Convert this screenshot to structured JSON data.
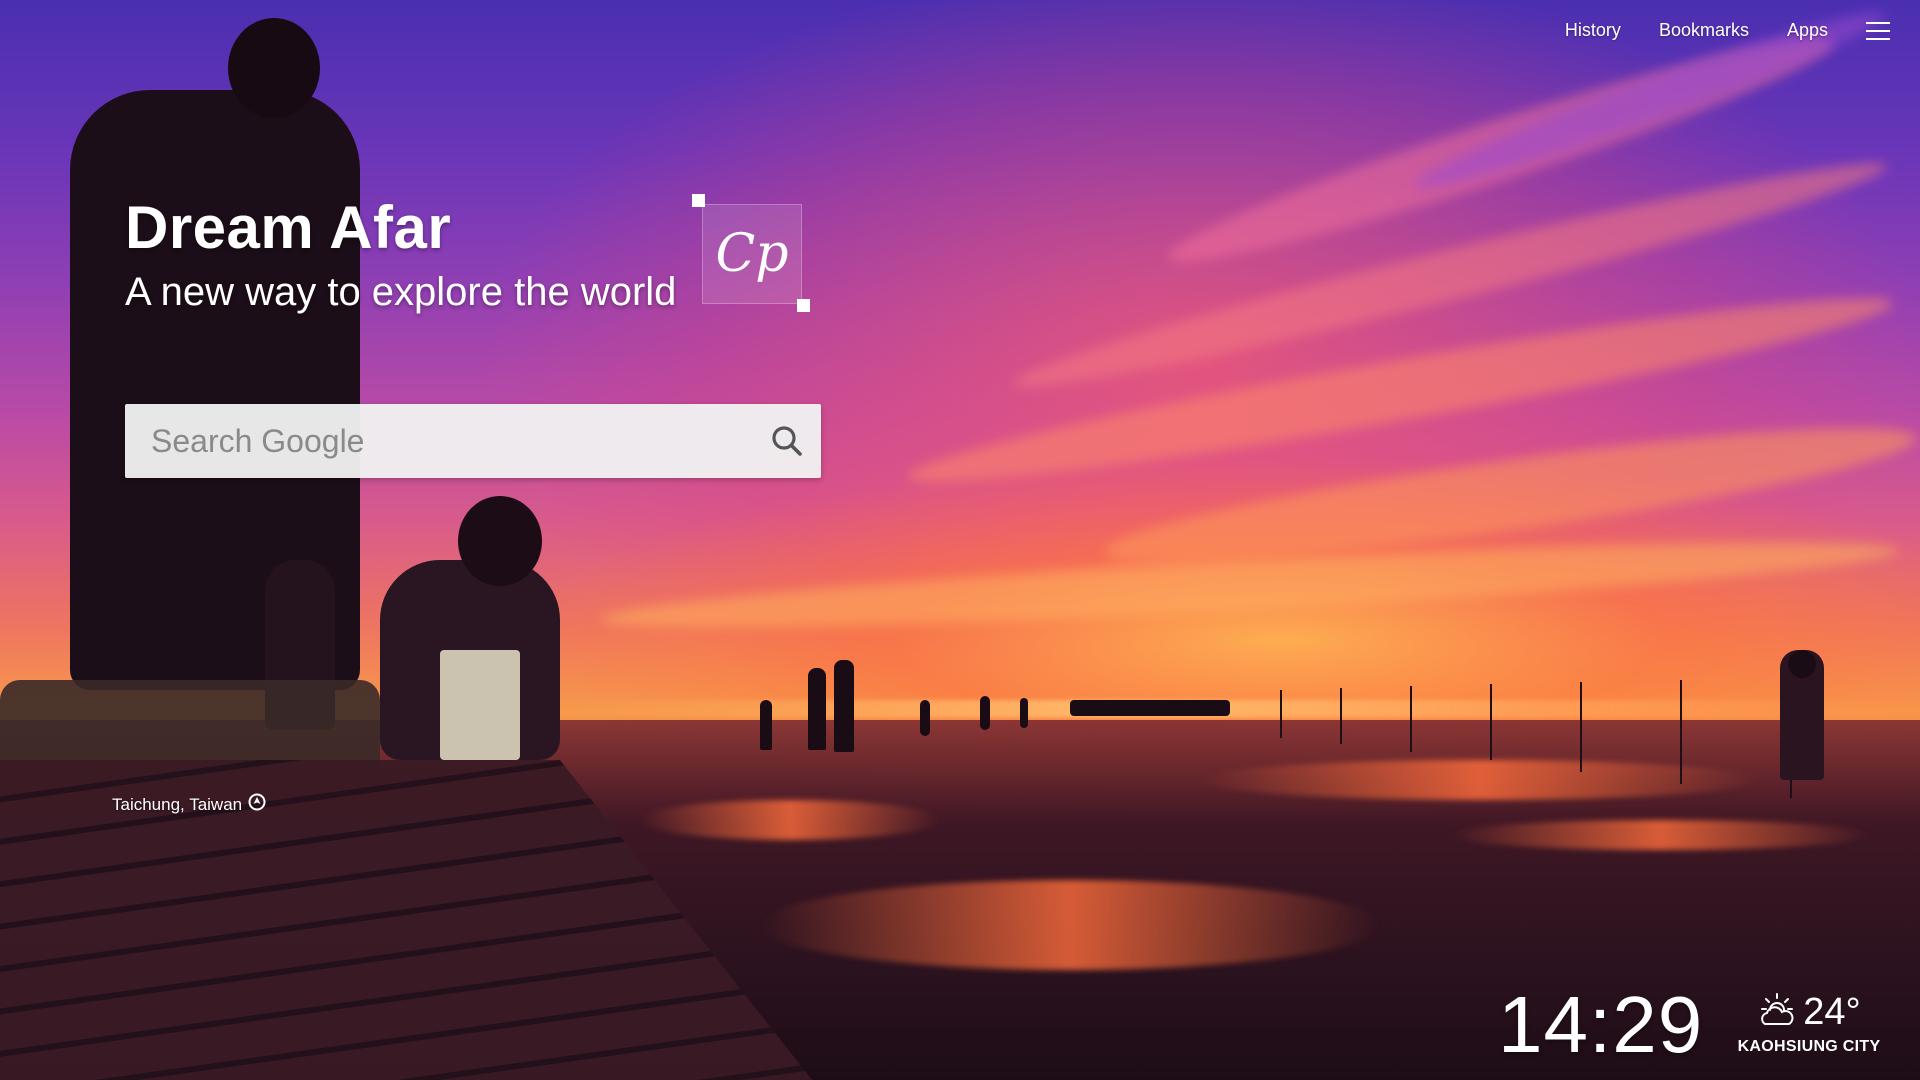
{
  "nav": {
    "history_label": "History",
    "bookmarks_label": "Bookmarks",
    "apps_label": "Apps",
    "menu_icon": "hamburger-menu-icon"
  },
  "brand": {
    "title": "Dream Afar",
    "subtitle": "A new way to explore the world",
    "logo_text": "Cp"
  },
  "search": {
    "placeholder": "Search Google",
    "value": "",
    "icon": "search-icon"
  },
  "location": {
    "label": "Taichung, Taiwan",
    "icon": "location-arrow-icon"
  },
  "clock": {
    "time": "14:29"
  },
  "weather": {
    "icon": "partly-cloudy-icon",
    "temperature": "24°",
    "city": "KAOHSIUNG CITY"
  },
  "colors": {
    "text": "#ffffff",
    "search_bg": "#f0f0f0",
    "placeholder": "#8a8a8a"
  }
}
